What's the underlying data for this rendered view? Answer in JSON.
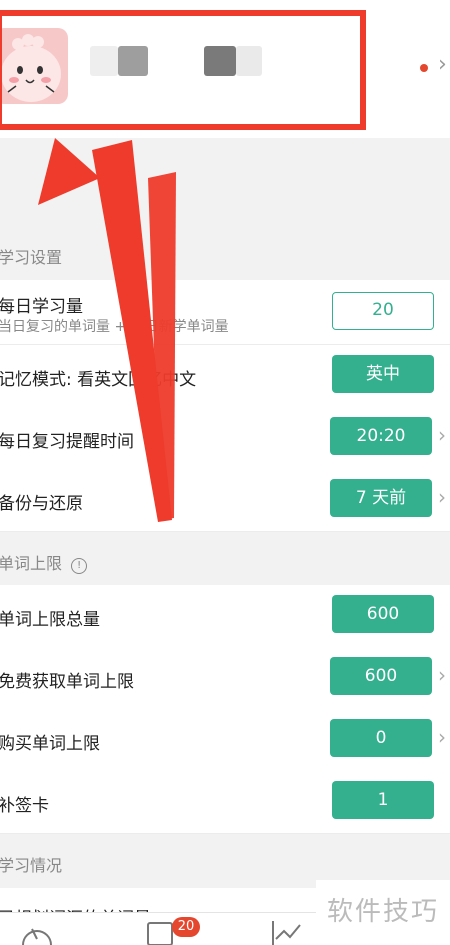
{
  "sections": {
    "study": "学习设置",
    "limit": "单词上限",
    "status": "学习情况"
  },
  "rows": {
    "daily_amount": {
      "label": "每日学习量",
      "sub": "当日复习的单词量 + 当日新学单词量",
      "value": "20"
    },
    "memory_mode": {
      "label": "记忆模式: 看英文回忆中文",
      "value": "英中"
    },
    "reminder": {
      "label": "每日复习提醒时间",
      "value": "20:20"
    },
    "backup": {
      "label": "备份与还原",
      "value": "7 天前"
    },
    "limit_total": {
      "label": "单词上限总量",
      "value": "600"
    },
    "free_limit": {
      "label": "免费获取单词上限",
      "value": "600"
    },
    "buy_limit": {
      "label": "购买单词上限",
      "value": "0"
    },
    "makeup_card": {
      "label": "补签卡",
      "value": "1"
    },
    "partial": {
      "label": "已规划词汇的单词量"
    }
  },
  "info_icon": "info-circle-icon",
  "bottom_nav": {
    "badge": "20"
  },
  "watermark": "软件技巧",
  "colors": {
    "accent": "#34b08e",
    "highlight": "#ee3b2b",
    "badge": "#e5472e"
  }
}
